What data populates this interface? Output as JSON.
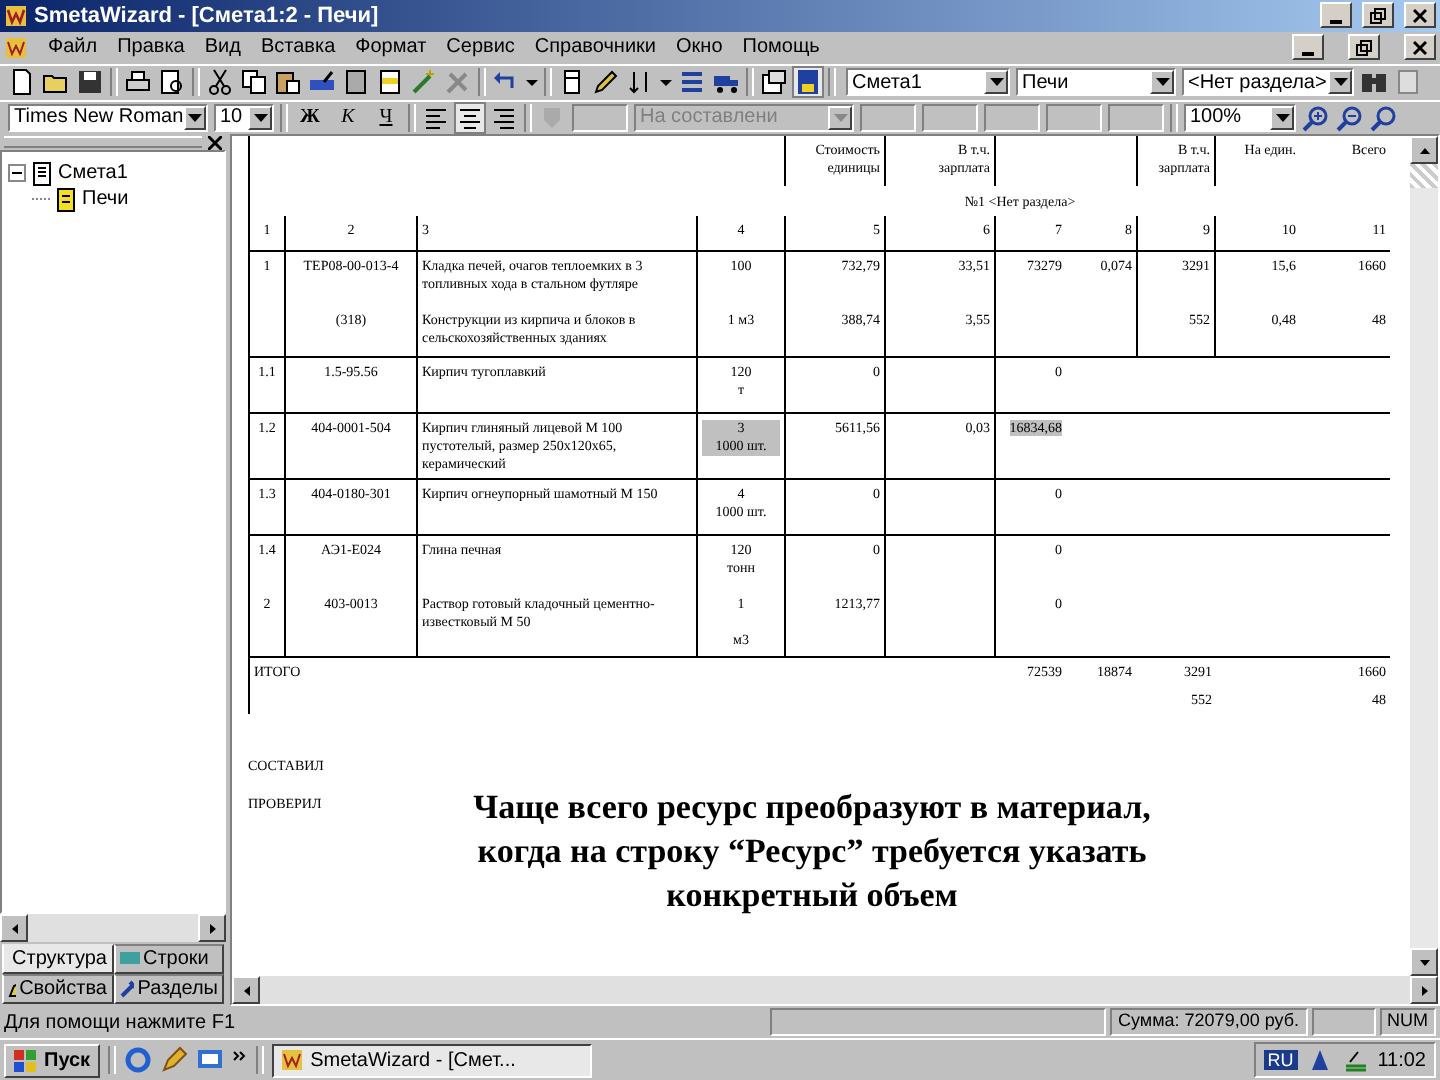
{
  "window": {
    "title": "SmetaWizard - [Смета1:2 - Печи]"
  },
  "menu": [
    "Файл",
    "Правка",
    "Вид",
    "Вставка",
    "Формат",
    "Сервис",
    "Справочники",
    "Окно",
    "Помощь"
  ],
  "toolbar": {
    "estimate": "Смета1",
    "chapter": "Печи",
    "section": "<Нет раздела>"
  },
  "format_bar": {
    "font": "Times New Roman",
    "size": "10",
    "bold": "Ж",
    "italic": "К",
    "underline": "Ч",
    "style_field": {
      "value": "На составлени",
      "disabled": true
    },
    "zoom": "100%"
  },
  "tree": [
    {
      "label": "Смета1",
      "kind": "estimate",
      "expanded": true,
      "children": [
        {
          "label": "Печи",
          "kind": "chapter"
        }
      ]
    }
  ],
  "panel_tabs": [
    {
      "label": "Структура",
      "selected": true
    },
    {
      "label": "Строки",
      "selected": false
    },
    {
      "label": "Свойства",
      "selected": false
    },
    {
      "label": "Разделы",
      "selected": false
    }
  ],
  "table": {
    "rows": [
      {
        "kind": "header",
        "cells": [
          null,
          null,
          null,
          null,
          {
            "text": "Стоимость\nединицы",
            "shaded": false
          },
          {
            "text": "В т.ч.\nзарплата",
            "shaded": false
          },
          null,
          null,
          {
            "text": "В т.ч.\nзарплата",
            "shaded": false
          },
          {
            "text": "На един.",
            "shaded": false
          },
          {
            "text": "Всего",
            "shaded": false
          }
        ]
      },
      {
        "kind": "section",
        "text": "№1 <Нет раздела>"
      },
      {
        "kind": "numbers",
        "cells": [
          {
            "text": "1",
            "shaded": false
          },
          {
            "text": "2",
            "shaded": false
          },
          {
            "text": "3",
            "shaded": false
          },
          {
            "text": "4",
            "shaded": false
          },
          {
            "text": "5",
            "shaded": false
          },
          {
            "text": "6",
            "shaded": false
          },
          {
            "text": "7",
            "shaded": false
          },
          {
            "text": "8",
            "shaded": false
          },
          {
            "text": "9",
            "shaded": false
          },
          {
            "text": "10",
            "shaded": false
          },
          {
            "text": "11",
            "shaded": false
          }
        ]
      },
      {
        "kind": "item",
        "cells": [
          {
            "text": "1",
            "shaded": false
          },
          {
            "text": "ТЕР08-00-013-4",
            "shaded": false
          },
          {
            "text": "Кладка печей, очагов теплоемких в 3 топливных хода в стальном футляре",
            "shaded": false
          },
          {
            "text": "100",
            "shaded": false
          },
          {
            "text": "732,79",
            "shaded": false
          },
          {
            "text": "33,51",
            "shaded": false
          },
          {
            "text": "73279",
            "shaded": false
          },
          {
            "text": "0,074",
            "shaded": false
          },
          {
            "text": "3291",
            "shaded": false
          },
          {
            "text": "15,6",
            "shaded": false
          },
          {
            "text": "1660",
            "shaded": false
          }
        ]
      },
      {
        "kind": "item_cont",
        "cells": [
          null,
          {
            "text": "(318)",
            "shaded": false
          },
          {
            "text": "Конструкции из кирпича и блоков в сельскохозяйственных зданиях",
            "shaded": false
          },
          {
            "text": "1 м3",
            "shaded": false
          },
          {
            "text": "388,74",
            "shaded": false
          },
          {
            "text": "3,55",
            "shaded": false
          },
          null,
          null,
          {
            "text": "552",
            "shaded": false
          },
          {
            "text": "0,48",
            "shaded": false
          },
          {
            "text": "48",
            "shaded": false
          }
        ]
      },
      {
        "kind": "item",
        "cells": [
          {
            "text": "1.1",
            "shaded": false
          },
          {
            "text": "1.5-95.56",
            "shaded": false
          },
          {
            "text": "Кирпич тугоплавкий",
            "shaded": false
          },
          {
            "text": "120\nт",
            "shaded": false
          },
          {
            "text": "0",
            "shaded": false
          },
          null,
          {
            "text": "0",
            "shaded": false
          },
          null,
          null,
          null,
          null
        ]
      },
      {
        "kind": "item",
        "cells": [
          {
            "text": "1.2",
            "shaded": false
          },
          {
            "text": "404-0001-504",
            "shaded": false
          },
          {
            "text": "Кирпич глиняный лицевой М 100 пустотелый, размер 250х120х65, керамический",
            "shaded": false
          },
          {
            "text": "3\n1000 шт.",
            "shaded": true
          },
          {
            "text": "5611,56",
            "shaded": false
          },
          {
            "text": "0,03",
            "shaded": false
          },
          {
            "text": "16834,68",
            "shaded": true
          },
          null,
          null,
          null,
          null
        ]
      },
      {
        "kind": "item",
        "cells": [
          {
            "text": "1.3",
            "shaded": false
          },
          {
            "text": "404-0180-301",
            "shaded": false
          },
          {
            "text": "Кирпич огнеупорный шамотный М 150",
            "shaded": false
          },
          {
            "text": "4\n1000 шт.",
            "shaded": false
          },
          {
            "text": "0",
            "shaded": false
          },
          null,
          {
            "text": "0",
            "shaded": false
          },
          null,
          null,
          null,
          null
        ]
      },
      {
        "kind": "item",
        "cells": [
          {
            "text": "1.4",
            "shaded": false
          },
          {
            "text": "АЭ1-Е024",
            "shaded": false
          },
          {
            "text": "Глина печная",
            "shaded": false
          },
          {
            "text": "120\nтонн",
            "shaded": false
          },
          {
            "text": "0",
            "shaded": false
          },
          null,
          {
            "text": "0",
            "shaded": false
          },
          null,
          null,
          null,
          null
        ]
      },
      {
        "kind": "item_cont",
        "cells": [
          {
            "text": "2",
            "shaded": false
          },
          {
            "text": "403-0013",
            "shaded": false
          },
          {
            "text": "Раствор готовый кладочный цементно-известковый М 50",
            "shaded": false
          },
          {
            "text": "1\n\nм3",
            "shaded": false
          },
          {
            "text": "1213,77",
            "shaded": false
          },
          null,
          {
            "text": "0",
            "shaded": false
          },
          null,
          null,
          null,
          null
        ]
      },
      {
        "kind": "total",
        "cells": [
          {
            "text": "ИТОГО",
            "shaded": false
          },
          null,
          null,
          null,
          null,
          null,
          {
            "text": "72539",
            "shaded": false
          },
          {
            "text": "18874",
            "shaded": false
          },
          {
            "text": "3291",
            "shaded": false
          },
          null,
          {
            "text": "1660",
            "shaded": false
          }
        ]
      },
      {
        "kind": "total_sub",
        "cells": [
          null,
          null,
          null,
          null,
          null,
          null,
          null,
          null,
          {
            "text": "552",
            "shaded": false
          },
          null,
          {
            "text": "48",
            "shaded": false
          }
        ]
      }
    ]
  },
  "signatures": [
    "СОСТАВИЛ",
    "ПРОВЕРИЛ"
  ],
  "caption": "Чаще всего ресурс преобразуют в материал, когда  на строку “Ресурс” требуется указать конкретный объем",
  "status_bar": {
    "hint": "Для помощи нажмите F1",
    "sum": "Сумма: 72079,00 руб.",
    "num": "NUM"
  },
  "taskbar": {
    "start": "Пуск",
    "task": "SmetaWizard - [Смет...",
    "lang": "RU",
    "time": "11:02"
  }
}
